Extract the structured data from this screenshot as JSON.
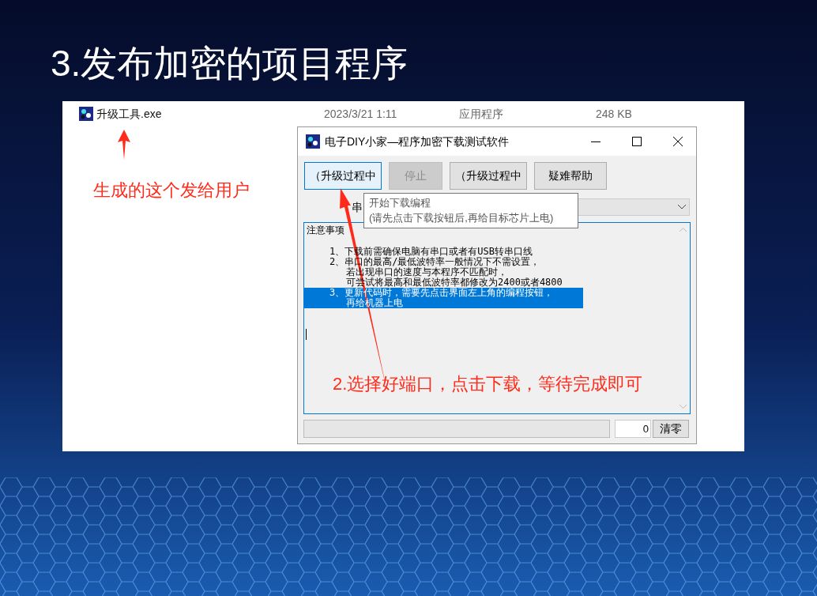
{
  "slide_title": "3.发布加密的项目程序",
  "file_row": {
    "name": "升级工具.exe",
    "date": "2023/3/21 1:11",
    "type": "应用程序",
    "size": "248 KB"
  },
  "annotations": [
    "生成的这个发给用户",
    "2.选择好端口，点击下载，等待完成即可"
  ],
  "window": {
    "title": "电子DIY小家—程序加密下载测试软件",
    "buttons": [
      {
        "label": "（升级过程中",
        "selected": true,
        "disabled": false
      },
      {
        "label": "停止",
        "selected": false,
        "disabled": true
      },
      {
        "label": "（升级过程中",
        "selected": false,
        "disabled": false
      },
      {
        "label": "疑难帮助",
        "selected": false,
        "disabled": false
      }
    ],
    "port_label": "串",
    "tooltip": [
      "开始下载编程",
      "(请先点击下载按钮后,再给目标芯片上电)"
    ],
    "log_lines": [
      {
        "kind": "heading",
        "text": "注意事项",
        "selected": false
      },
      {
        "kind": "item",
        "text": "1、下载前需确保电脑有串口或者有USB转串口线",
        "selected": false
      },
      {
        "kind": "item",
        "text": "2、串口的最高/最低波特率一般情况下不需设置，",
        "selected": false
      },
      {
        "kind": "continuation",
        "text": "若出现串口的速度与本程序不匹配时，",
        "selected": false
      },
      {
        "kind": "continuation",
        "text": "可尝试将最高和最低波特率都修改为2400或者4800",
        "selected": false
      },
      {
        "kind": "item",
        "text": "3、更新代码时，需要先点击界面左上角的编程按钮，",
        "selected": true
      },
      {
        "kind": "continuation",
        "text": "再给机器上电",
        "selected": true
      }
    ],
    "progress": {
      "level": 0
    },
    "counter": "0",
    "clear_button": "清零"
  }
}
